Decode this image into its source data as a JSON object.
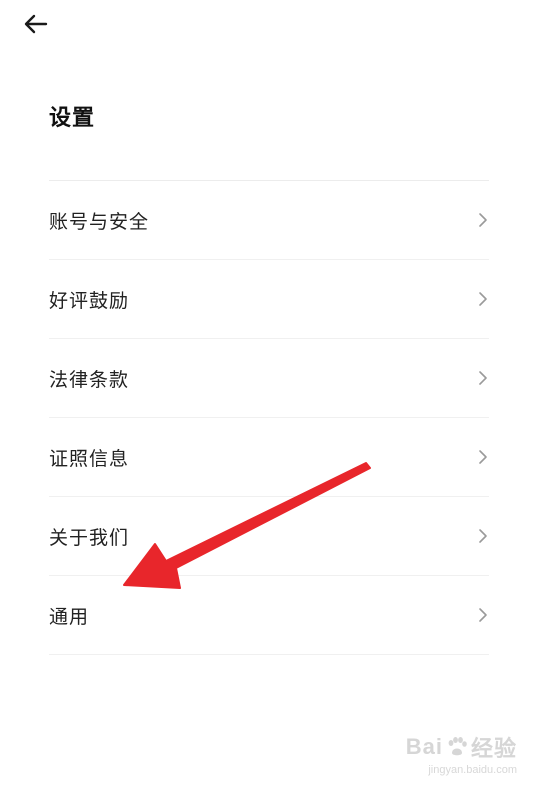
{
  "header": {
    "back_icon": "arrow-left-icon",
    "title": "设置"
  },
  "menu": {
    "items": [
      {
        "label": "账号与安全",
        "icon": "chevron-right-icon"
      },
      {
        "label": "好评鼓励",
        "icon": "chevron-right-icon"
      },
      {
        "label": "法律条款",
        "icon": "chevron-right-icon"
      },
      {
        "label": "证照信息",
        "icon": "chevron-right-icon"
      },
      {
        "label": "关于我们",
        "icon": "chevron-right-icon"
      },
      {
        "label": "通用",
        "icon": "chevron-right-icon"
      }
    ]
  },
  "annotation": {
    "arrow_color": "#e8262b",
    "points_to": "通用"
  },
  "watermark": {
    "brand_left": "Bai",
    "brand_right": "经验",
    "url": "jingyan.baidu.com"
  },
  "colors": {
    "background": "#ffffff",
    "text": "#222222",
    "divider": "#f0f0f0",
    "chevron": "#9a9a9a"
  }
}
